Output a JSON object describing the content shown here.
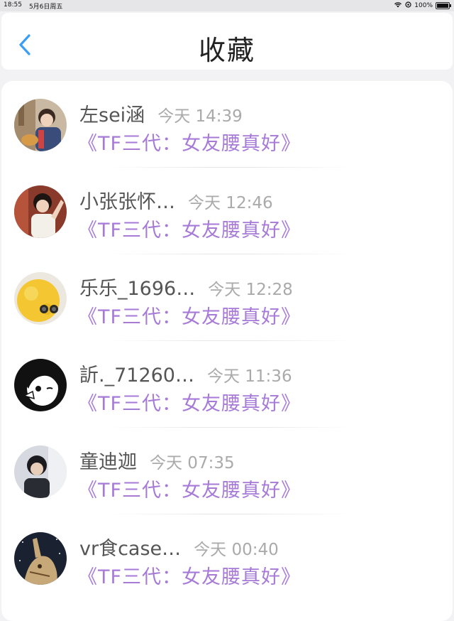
{
  "status": {
    "time": "18:55",
    "date": "5月6日周五",
    "battery": "100%"
  },
  "header": {
    "title": "收藏"
  },
  "items": [
    {
      "name": "左sei涵",
      "time": "今天 14:39",
      "message": "《TF三代：女友腰真好》"
    },
    {
      "name": "小张张怀…",
      "time": "今天 12:46",
      "message": "《TF三代：女友腰真好》"
    },
    {
      "name": "乐乐_1696…",
      "time": "今天 12:28",
      "message": "《TF三代：女友腰真好》"
    },
    {
      "name": "訢._71260…",
      "time": "今天 11:36",
      "message": "《TF三代：女友腰真好》"
    },
    {
      "name": "童迪迦",
      "time": "今天 07:35",
      "message": "《TF三代：女友腰真好》"
    },
    {
      "name": "vr食case…",
      "time": "今天 00:40",
      "message": "《TF三代：女友腰真好》"
    }
  ],
  "colors": {
    "accent": "#3a9ef5",
    "message": "#a77ad8"
  }
}
